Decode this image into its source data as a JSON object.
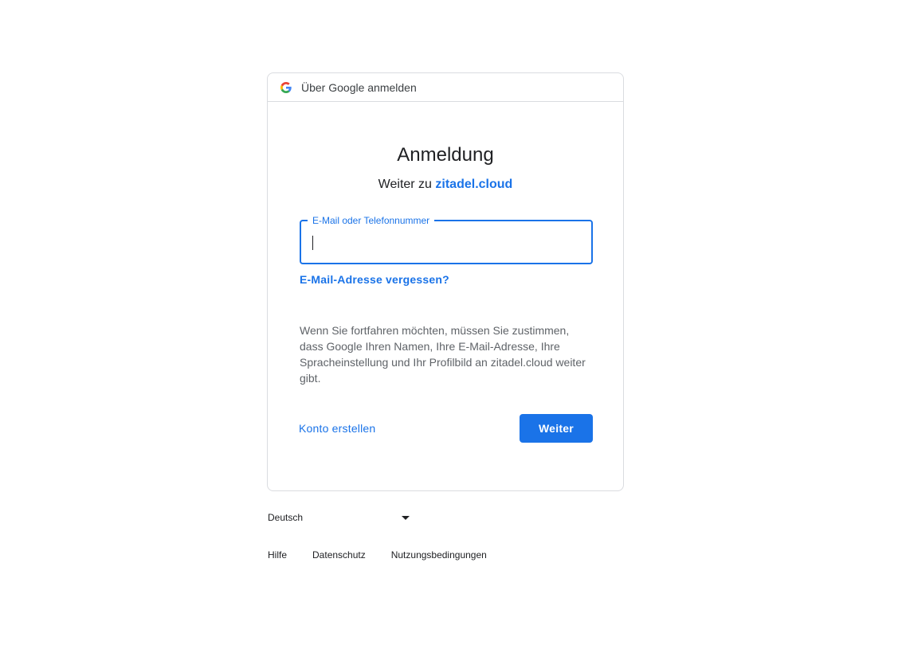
{
  "header": {
    "text": "Über Google anmelden",
    "logo_icon": "google-g-icon"
  },
  "main": {
    "title": "Anmeldung",
    "subtitle_prefix": "Weiter zu ",
    "subtitle_site": "zitadel.cloud",
    "email_field": {
      "label": "E-Mail oder Telefonnummer",
      "value": ""
    },
    "forgot_email_link": "E-Mail-Adresse vergessen?",
    "consent_text": "Wenn Sie fortfahren möchten, müssen Sie zustimmen, dass Google Ihren Namen, Ihre E-Mail-Adresse, Ihre Spracheinstellung und Ihr Profilbild an zitadel.cloud weiter gibt.",
    "create_account_link": "Konto erstellen",
    "next_button": "Weiter"
  },
  "footer": {
    "language": "Deutsch",
    "links": {
      "help": "Hilfe",
      "privacy": "Datenschutz",
      "terms": "Nutzungsbedingungen"
    }
  },
  "colors": {
    "accent": "#1a73e8",
    "border": "#dadce0",
    "text": "#202124",
    "muted": "#5f6368"
  }
}
